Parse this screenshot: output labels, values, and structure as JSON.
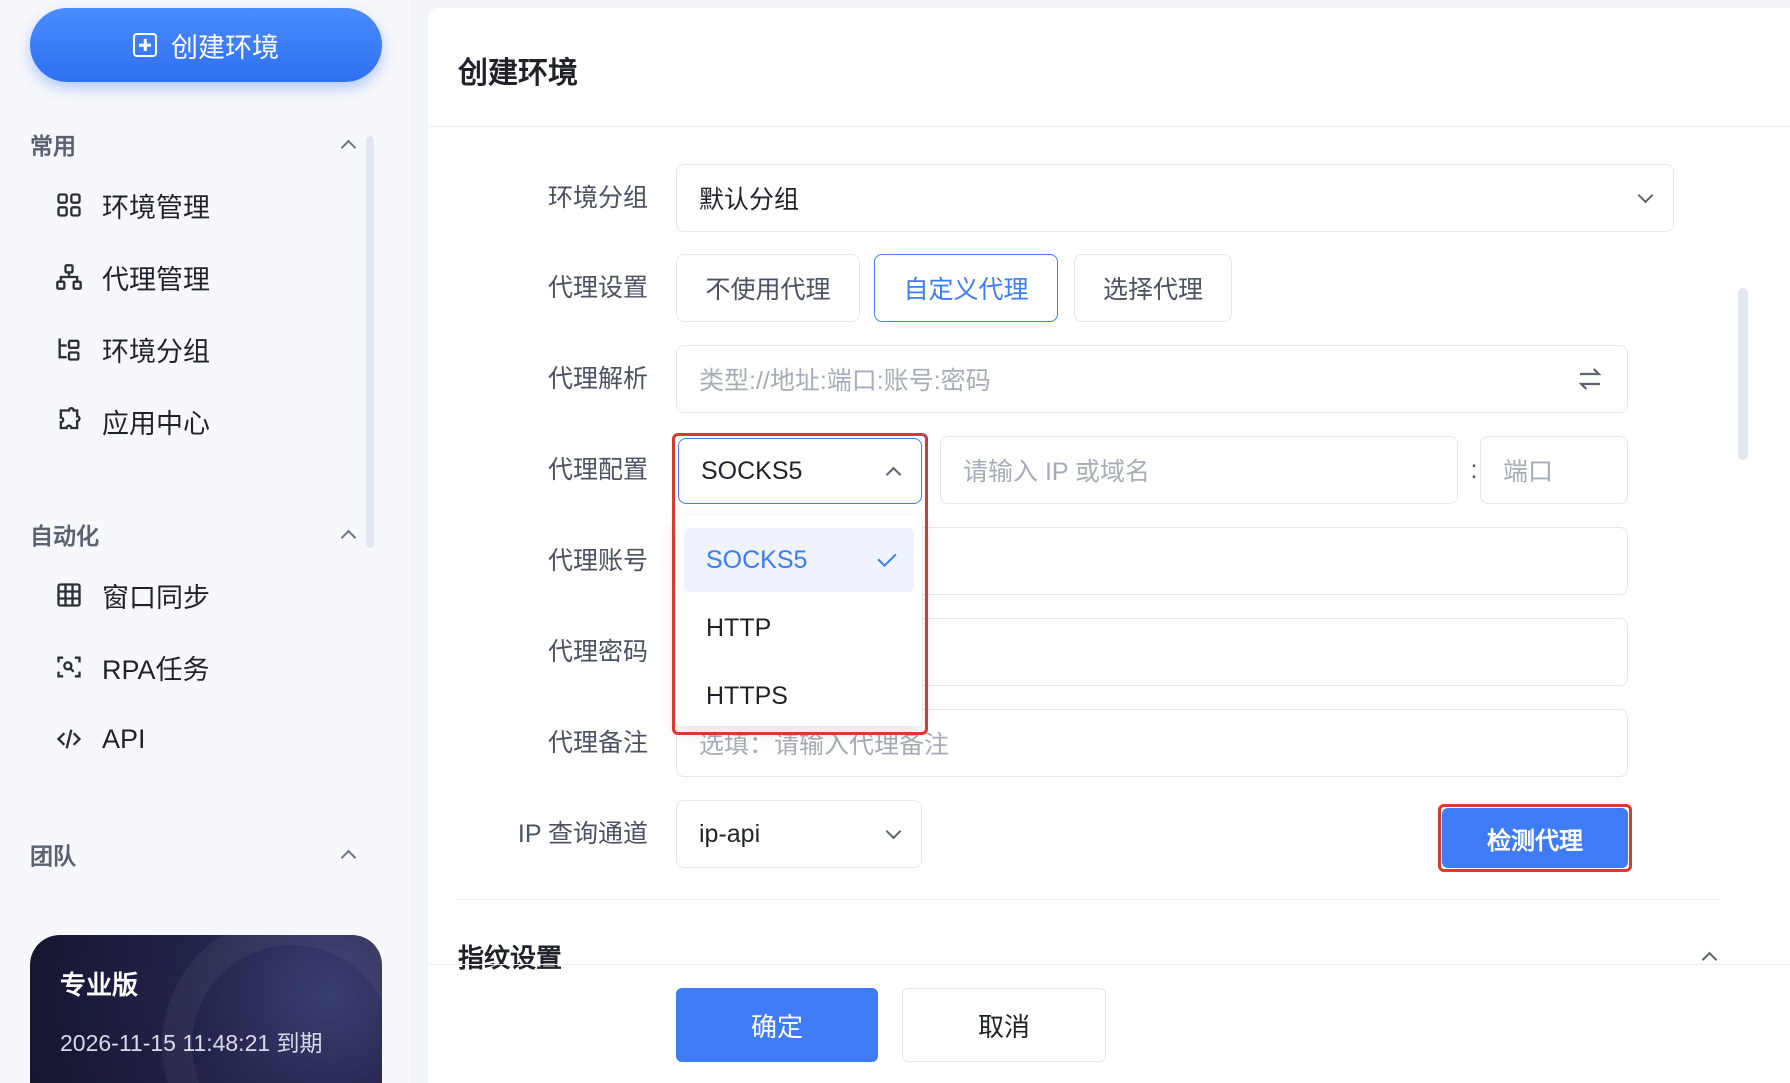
{
  "sidebar": {
    "create_button": "创建环境",
    "sections": [
      {
        "title": "常用",
        "items": [
          "环境管理",
          "代理管理",
          "环境分组",
          "应用中心"
        ]
      },
      {
        "title": "自动化",
        "items": [
          "窗口同步",
          "RPA任务",
          "API"
        ]
      },
      {
        "title": "团队",
        "items": []
      }
    ],
    "plan": {
      "title": "专业版",
      "expiry": "2026-11-15 11:48:21 到期"
    }
  },
  "panel": {
    "title": "创建环境",
    "group": {
      "label": "环境分组",
      "value": "默认分组"
    },
    "proxy_setting": {
      "label": "代理设置",
      "options": [
        "不使用代理",
        "自定义代理",
        "选择代理"
      ],
      "active": "自定义代理"
    },
    "proxy_parse": {
      "label": "代理解析",
      "placeholder": "类型://地址:端口:账号:密码"
    },
    "proxy_config": {
      "label": "代理配置",
      "type_value": "SOCKS5",
      "host_placeholder": "请输入 IP 或域名",
      "separator": ":",
      "port_placeholder": "端口",
      "dropdown_options": [
        "SOCKS5",
        "HTTP",
        "HTTPS"
      ],
      "selected_option": "SOCKS5"
    },
    "proxy_account": {
      "label": "代理账号"
    },
    "proxy_password": {
      "label": "代理密码"
    },
    "proxy_note": {
      "label": "代理备注",
      "placeholder": "选填：请输入代理备注"
    },
    "ip_channel": {
      "label": "IP 查询通道",
      "value": "ip-api"
    },
    "detect_button": "检测代理",
    "fingerprint_section": "指纹设置",
    "confirm_button": "确定",
    "cancel_button": "取消"
  },
  "colors": {
    "primary": "#3e7bf5",
    "highlight_frame": "#d93a2f",
    "plan_card": "#1c1d3b"
  }
}
